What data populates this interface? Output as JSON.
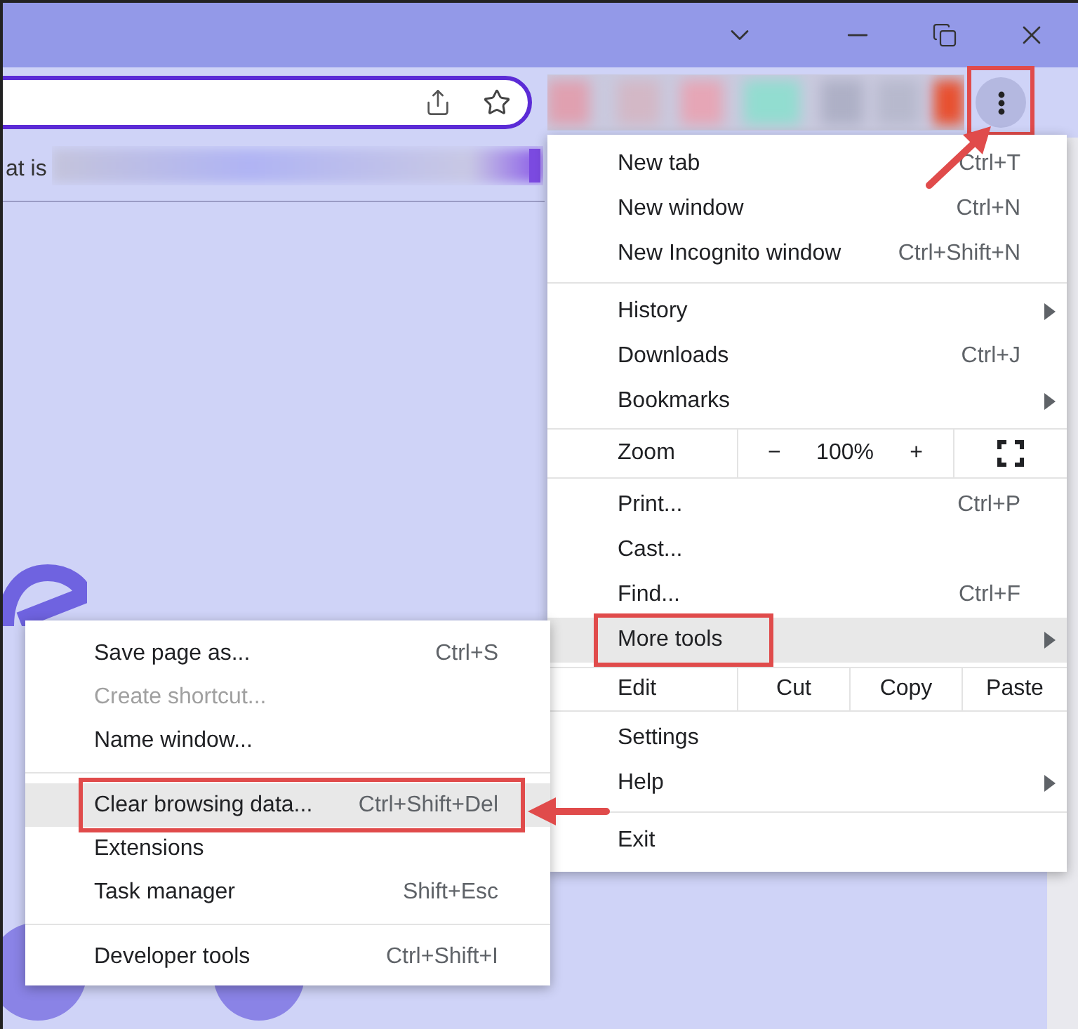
{
  "bookmark_bar": {
    "text": "at is"
  },
  "menu_button": {
    "annotated": true
  },
  "menu": {
    "items": [
      {
        "kind": "item",
        "label": "New tab",
        "shortcut": "Ctrl+T",
        "has_submenu": false,
        "highlighted": false,
        "annotated": false
      },
      {
        "kind": "item",
        "label": "New window",
        "shortcut": "Ctrl+N",
        "has_submenu": false,
        "highlighted": false,
        "annotated": false
      },
      {
        "kind": "item",
        "label": "New Incognito window",
        "shortcut": "Ctrl+Shift+N",
        "has_submenu": false,
        "highlighted": false,
        "annotated": false
      },
      {
        "kind": "divider"
      },
      {
        "kind": "item",
        "label": "History",
        "has_submenu": true,
        "highlighted": false,
        "annotated": false
      },
      {
        "kind": "item",
        "label": "Downloads",
        "shortcut": "Ctrl+J",
        "has_submenu": false,
        "highlighted": false,
        "annotated": false
      },
      {
        "kind": "item",
        "label": "Bookmarks",
        "has_submenu": true,
        "highlighted": false,
        "annotated": false
      },
      {
        "kind": "zoom",
        "label": "Zoom",
        "minus": "−",
        "value": "100%",
        "plus": "+"
      },
      {
        "kind": "item",
        "label": "Print...",
        "shortcut": "Ctrl+P",
        "has_submenu": false,
        "highlighted": false,
        "annotated": false
      },
      {
        "kind": "item",
        "label": "Cast...",
        "has_submenu": false,
        "highlighted": false,
        "annotated": false
      },
      {
        "kind": "item",
        "label": "Find...",
        "shortcut": "Ctrl+F",
        "has_submenu": false,
        "highlighted": false,
        "annotated": false
      },
      {
        "kind": "item",
        "label": "More tools",
        "has_submenu": true,
        "highlighted": true,
        "annotated": true
      },
      {
        "kind": "edit",
        "label": "Edit",
        "buttons": [
          "Cut",
          "Copy",
          "Paste"
        ]
      },
      {
        "kind": "item",
        "label": "Settings",
        "has_submenu": false,
        "highlighted": false,
        "annotated": false
      },
      {
        "kind": "item",
        "label": "Help",
        "has_submenu": true,
        "highlighted": false,
        "annotated": false
      },
      {
        "kind": "divider"
      },
      {
        "kind": "item",
        "label": "Exit",
        "has_submenu": false,
        "highlighted": false,
        "annotated": false
      }
    ]
  },
  "submenu": {
    "items": [
      {
        "kind": "item",
        "label": "Save page as...",
        "shortcut": "Ctrl+S",
        "disabled": false,
        "highlighted": false,
        "annotated": false
      },
      {
        "kind": "item",
        "label": "Create shortcut...",
        "disabled": true,
        "highlighted": false,
        "annotated": false
      },
      {
        "kind": "item",
        "label": "Name window...",
        "disabled": false,
        "highlighted": false,
        "annotated": false
      },
      {
        "kind": "divider"
      },
      {
        "kind": "item",
        "label": "Clear browsing data...",
        "shortcut": "Ctrl+Shift+Del",
        "disabled": false,
        "highlighted": true,
        "annotated": true
      },
      {
        "kind": "item",
        "label": "Extensions",
        "disabled": false,
        "highlighted": false,
        "annotated": false
      },
      {
        "kind": "item",
        "label": "Task manager",
        "shortcut": "Shift+Esc",
        "disabled": false,
        "highlighted": false,
        "annotated": false
      },
      {
        "kind": "divider"
      },
      {
        "kind": "item",
        "label": "Developer tools",
        "shortcut": "Ctrl+Shift+I",
        "disabled": false,
        "highlighted": false,
        "annotated": false
      }
    ]
  }
}
